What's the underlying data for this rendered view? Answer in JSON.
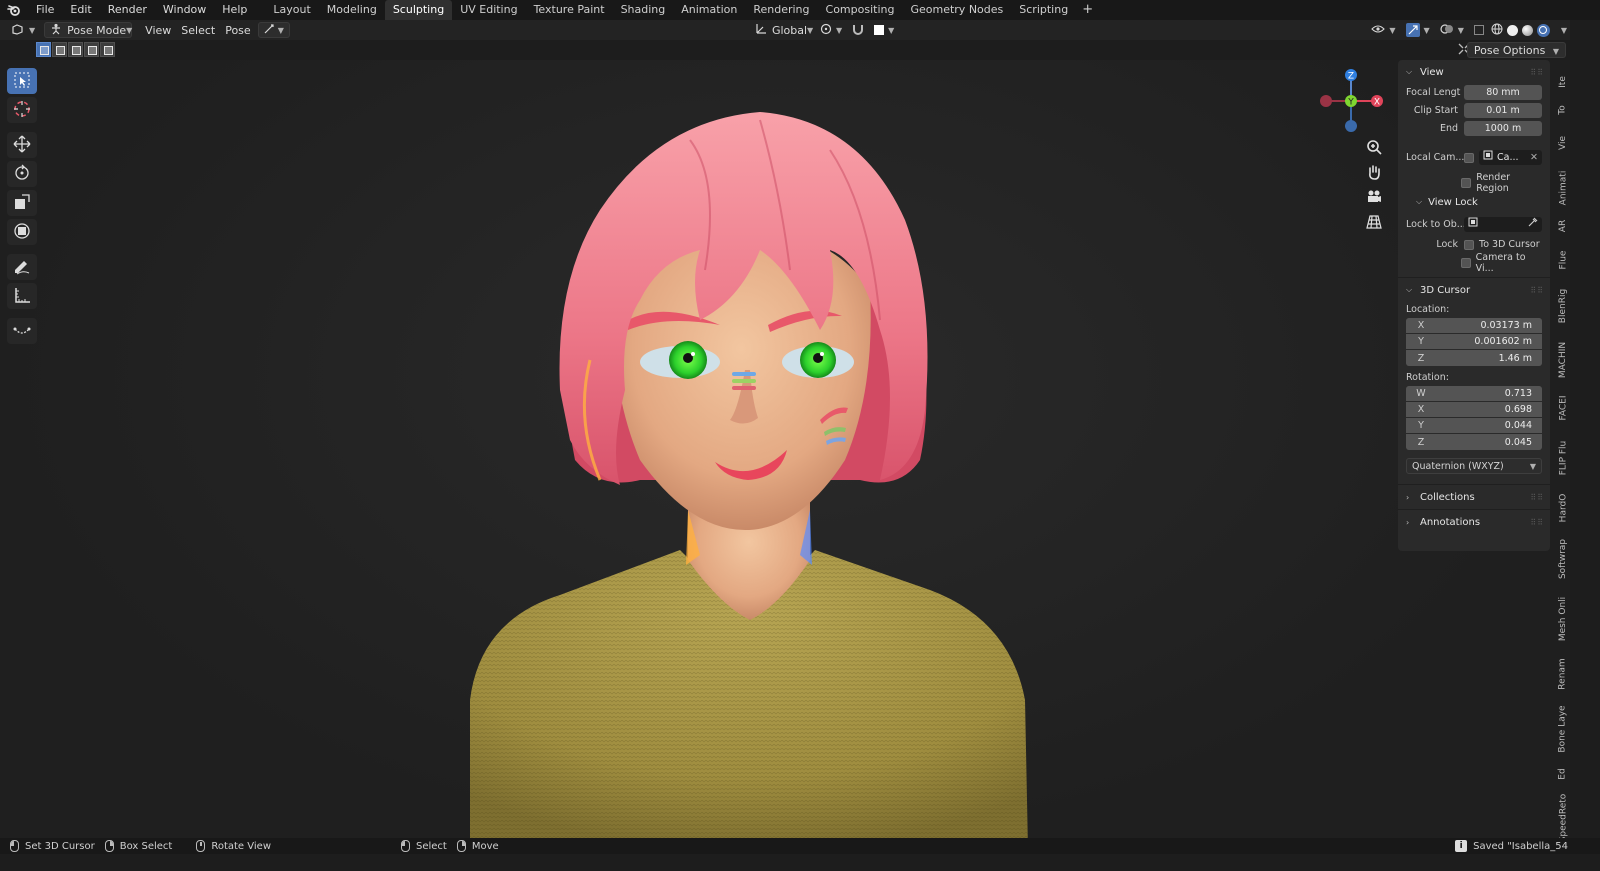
{
  "app": {
    "menus": [
      "File",
      "Edit",
      "Render",
      "Window",
      "Help"
    ],
    "workspaces": [
      "Layout",
      "Modeling",
      "Sculpting",
      "UV Editing",
      "Texture Paint",
      "Shading",
      "Animation",
      "Rendering",
      "Compositing",
      "Geometry Nodes",
      "Scripting"
    ],
    "active_workspace": "Sculpting",
    "add_workspace": "+"
  },
  "header": {
    "mode": "Pose Mode",
    "menus": [
      "View",
      "Select",
      "Pose"
    ],
    "transform_orientation": "Global",
    "pose_options": "Pose Options",
    "xray_close": "X"
  },
  "npanel": {
    "view": {
      "title": "View",
      "focal_length_label": "Focal Lengt",
      "focal_length": "80 mm",
      "clip_start_label": "Clip Start",
      "clip_start": "0.01 m",
      "end_label": "End",
      "clip_end": "1000 m",
      "local_camera_label": "Local Cam...",
      "local_camera_value": "Ca...",
      "render_region": "Render Region",
      "view_lock_title": "View Lock",
      "lock_to_object_label": "Lock to Ob...",
      "lock_label": "Lock",
      "to_3d_cursor": "To 3D Cursor",
      "camera_to_view": "Camera to Vi..."
    },
    "cursor": {
      "title": "3D Cursor",
      "location_label": "Location:",
      "location": [
        {
          "axis": "X",
          "value": "0.03173 m"
        },
        {
          "axis": "Y",
          "value": "0.001602 m"
        },
        {
          "axis": "Z",
          "value": "1.46 m"
        }
      ],
      "rotation_label": "Rotation:",
      "rotation": [
        {
          "axis": "W",
          "value": "0.713"
        },
        {
          "axis": "X",
          "value": "0.698"
        },
        {
          "axis": "Y",
          "value": "0.044"
        },
        {
          "axis": "Z",
          "value": "0.045"
        }
      ],
      "rotation_mode": "Quaternion (WXYZ)"
    },
    "collections_title": "Collections",
    "annotations_title": "Annotations"
  },
  "tabs": [
    "Ite",
    "To",
    "Vie",
    "Animati",
    "AR",
    "Flue",
    "BlenRig",
    "MACHIN",
    "FACEI",
    "FLIP Flu",
    "HardO",
    "Softwrap",
    "Mesh Onli",
    "Renam",
    "Bone Laye",
    "Ed",
    "SpeedReto"
  ],
  "gizmo": {
    "z": "Z",
    "y": "Y",
    "x": "X"
  },
  "status": {
    "set_cursor": "Set 3D Cursor",
    "box_select": "Box Select",
    "rotate_view": "Rotate View",
    "select": "Select",
    "move": "Move",
    "saved": "Saved \"Isabella_54"
  },
  "colors": {
    "accent": "#4772b3",
    "hair": "#f07a8e",
    "sweater": "#a59446",
    "skin": "#e9b58e",
    "eyes": "#3be03b"
  }
}
